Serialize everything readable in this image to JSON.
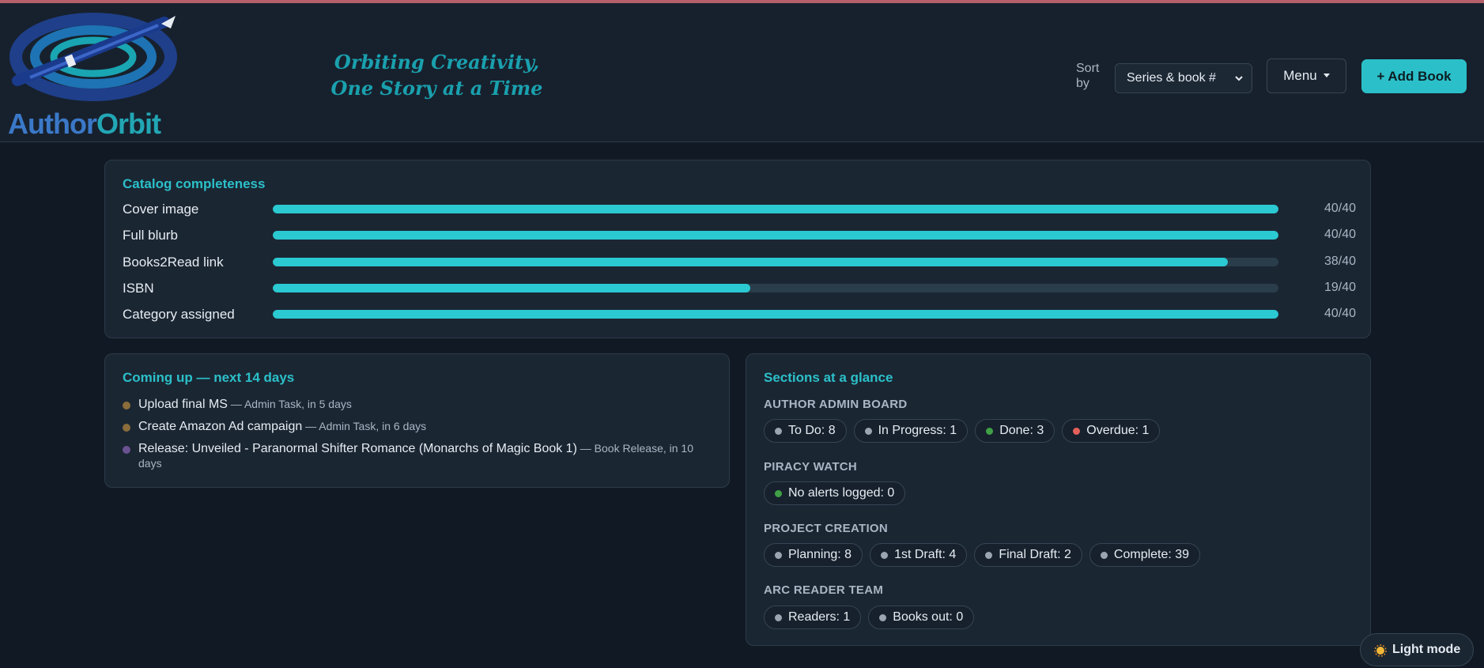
{
  "header": {
    "logo": {
      "part1": "Author",
      "part2": "Orbit",
      "icon": "pen-orbit-logo"
    },
    "tagline_line1": "Orbiting Creativity,",
    "tagline_line2": "One Story at a Time",
    "sort_label": "Sort by",
    "sort_value": "Series & book #",
    "menu_label": "Menu",
    "add_book_label": "+ Add Book"
  },
  "catalog": {
    "title": "Catalog completeness",
    "rows": [
      {
        "label": "Cover image",
        "count": "40/40",
        "fraction": 1.0
      },
      {
        "label": "Full blurb",
        "count": "40/40",
        "fraction": 1.0
      },
      {
        "label": "Books2Read link",
        "count": "38/40",
        "fraction": 0.95
      },
      {
        "label": "ISBN",
        "count": "19/40",
        "fraction": 0.475
      },
      {
        "label": "Category assigned",
        "count": "40/40",
        "fraction": 1.0
      }
    ]
  },
  "coming_up": {
    "title": "Coming up — next 14 days",
    "items": [
      {
        "title": "Upload final MS",
        "meta": " — Admin Task, in 5 days",
        "dot_color": "#8a6d3b"
      },
      {
        "title": "Create Amazon Ad campaign",
        "meta": " — Admin Task, in 6 days",
        "dot_color": "#8a6d3b"
      },
      {
        "title": "Release: Unveiled - Paranormal Shifter Romance (Monarchs of Magic Book 1)",
        "meta": " — Book Release, in 10 days",
        "dot_color": "#6a5290"
      }
    ]
  },
  "sections": {
    "title": "Sections at a glance",
    "groups": [
      {
        "title": "AUTHOR ADMIN BOARD",
        "chips": [
          {
            "label": "To Do: 8",
            "color": "#9aa5b1"
          },
          {
            "label": "In Progress: 1",
            "color": "#9aa5b1"
          },
          {
            "label": "Done: 3",
            "color": "#3fa046"
          },
          {
            "label": "Overdue: 1",
            "color": "#e4605a"
          }
        ]
      },
      {
        "title": "PIRACY WATCH",
        "chips": [
          {
            "label": "No alerts logged: 0",
            "color": "#3fa046"
          }
        ]
      },
      {
        "title": "PROJECT CREATION",
        "chips": [
          {
            "label": "Planning: 8",
            "color": "#9aa5b1"
          },
          {
            "label": "1st Draft: 4",
            "color": "#9aa5b1"
          },
          {
            "label": "Final Draft: 2",
            "color": "#9aa5b1"
          },
          {
            "label": "Complete: 39",
            "color": "#9aa5b1"
          }
        ]
      },
      {
        "title": "ARC READER TEAM",
        "chips": [
          {
            "label": "Readers: 1",
            "color": "#9aa5b1"
          },
          {
            "label": "Books out: 0",
            "color": "#9aa5b1"
          }
        ]
      }
    ]
  },
  "theme_toggle": {
    "label": "Light mode",
    "icon": "sun-icon"
  },
  "colors": {
    "accent": "#2bc0c9",
    "background": "#111a24",
    "card": "#1b2633"
  }
}
